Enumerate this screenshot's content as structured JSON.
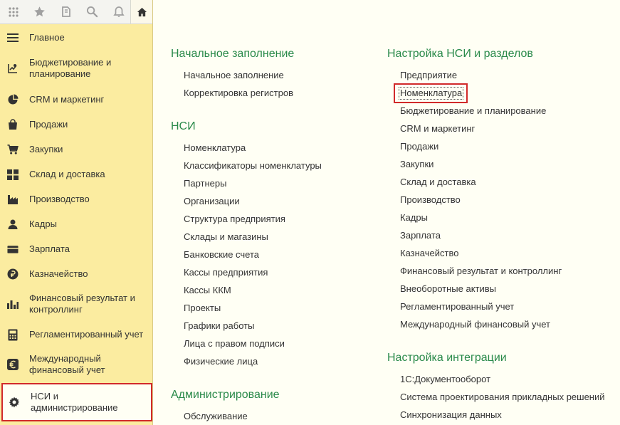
{
  "sidebar": {
    "items": [
      {
        "label": "Главное",
        "icon": "menu-lines-icon"
      },
      {
        "label": "Бюджетирование и планирование",
        "icon": "budget-chart-icon"
      },
      {
        "label": "CRM и маркетинг",
        "icon": "pie-chart-icon"
      },
      {
        "label": "Продажи",
        "icon": "shopping-bag-icon"
      },
      {
        "label": "Закупки",
        "icon": "cart-icon"
      },
      {
        "label": "Склад и доставка",
        "icon": "warehouse-grid-icon"
      },
      {
        "label": "Производство",
        "icon": "factory-icon"
      },
      {
        "label": "Кадры",
        "icon": "person-icon"
      },
      {
        "label": "Зарплата",
        "icon": "wallet-icon"
      },
      {
        "label": "Казначейство",
        "icon": "ruble-coin-icon"
      },
      {
        "label": "Финансовый результат и контроллинг",
        "icon": "bar-chart-icon"
      },
      {
        "label": "Регламентированный учет",
        "icon": "calculator-icon"
      },
      {
        "label": "Международный финансовый учет",
        "icon": "euro-icon"
      },
      {
        "label": "НСИ и администрирование",
        "icon": "gear-icon",
        "active": true
      }
    ]
  },
  "main": {
    "left": [
      {
        "title": "Начальное заполнение",
        "links": [
          "Начальное заполнение",
          "Корректировка регистров"
        ]
      },
      {
        "title": "НСИ",
        "links": [
          "Номенклатура",
          "Классификаторы номенклатуры",
          "Партнеры",
          "Организации",
          "Структура предприятия",
          "Склады и магазины",
          "Банковские счета",
          "Кассы предприятия",
          "Кассы ККМ",
          "Проекты",
          "Графики работы",
          "Лица с правом подписи",
          "Физические лица"
        ]
      },
      {
        "title": "Администрирование",
        "links": [
          "Обслуживание"
        ]
      }
    ],
    "right": [
      {
        "title": "Настройка НСИ и разделов",
        "links": [
          "Предприятие",
          "Номенклатура",
          "Бюджетирование и планирование",
          "CRM и маркетинг",
          "Продажи",
          "Закупки",
          "Склад и доставка",
          "Производство",
          "Кадры",
          "Зарплата",
          "Казначейство",
          "Финансовый результат и контроллинг",
          "Внеоборотные активы",
          "Регламентированный учет",
          "Международный финансовый учет"
        ]
      },
      {
        "title": "Настройка интеграции",
        "links": [
          "1С:Документооборот",
          "Система проектирования прикладных решений",
          "Синхронизация данных"
        ]
      }
    ]
  },
  "colors": {
    "sidebar_bg": "#fbeca0",
    "section_title": "#2a8a4a",
    "highlight_border": "#d12a2a",
    "page_bg": "#fffff4"
  }
}
